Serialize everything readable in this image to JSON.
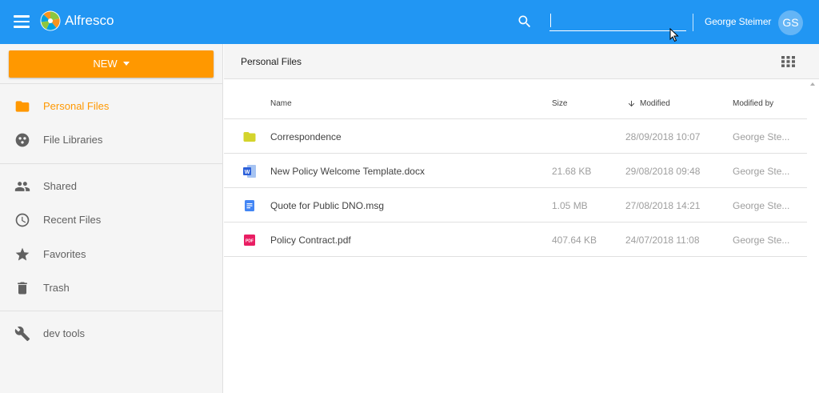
{
  "app": {
    "title": "Alfresco"
  },
  "header": {
    "search": {
      "value": "",
      "placeholder": ""
    },
    "user_name": "George Steimer",
    "avatar_initials": "GS"
  },
  "sidebar": {
    "new_label": "NEW",
    "items": [
      {
        "label": "Personal Files",
        "icon": "folder-icon",
        "active": true
      },
      {
        "label": "File Libraries",
        "icon": "libraries-icon"
      },
      {
        "label": "Shared",
        "icon": "people-icon"
      },
      {
        "label": "Recent Files",
        "icon": "clock-icon"
      },
      {
        "label": "Favorites",
        "icon": "star-icon"
      },
      {
        "label": "Trash",
        "icon": "trash-icon"
      },
      {
        "label": "dev tools",
        "icon": "wrench-icon"
      }
    ]
  },
  "main": {
    "breadcrumb": "Personal Files",
    "columns": {
      "name": "Name",
      "size": "Size",
      "modified": "Modified",
      "modified_by": "Modified by"
    },
    "rows": [
      {
        "name": "Correspondence",
        "size": "",
        "modified": "28/09/2018 10:07",
        "modified_by": "George Ste...",
        "type": "folder"
      },
      {
        "name": "New Policy Welcome Template.docx",
        "size": "21.68 KB",
        "modified": "29/08/2018 09:48",
        "modified_by": "George Ste...",
        "type": "word"
      },
      {
        "name": "Quote for Public DNO.msg",
        "size": "1.05 MB",
        "modified": "27/08/2018 14:21",
        "modified_by": "George Ste...",
        "type": "doc"
      },
      {
        "name": "Policy Contract.pdf",
        "size": "407.64 KB",
        "modified": "24/07/2018 11:08",
        "modified_by": "George Ste...",
        "type": "pdf"
      }
    ]
  },
  "colors": {
    "header": "#2196f3",
    "accent": "#ff9800",
    "folder": "#d4d42c",
    "word": "#2b5fd9",
    "doc": "#4285f4",
    "pdf": "#e91e63"
  }
}
